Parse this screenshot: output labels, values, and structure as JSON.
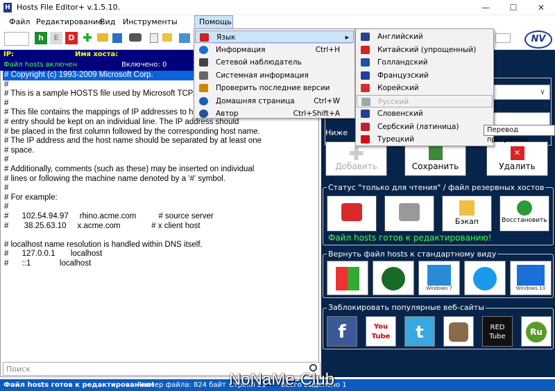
{
  "window": {
    "title": "Hosts File Editor+ v.1.5.10.",
    "icon_letter": "H",
    "min": "—",
    "max": "☐",
    "close": "✕"
  },
  "menubar": {
    "items": [
      "Файл",
      "Редактирование",
      "Вид",
      "Инструменты"
    ],
    "help": "Помощь"
  },
  "toolbar": {
    "h": "h",
    "e": "E",
    "d": "D"
  },
  "table_header": {
    "ip": "IP:",
    "host": "Имя хоста:"
  },
  "hosts_bar": {
    "left": "Файл hosts включен",
    "right": "Включено: 0"
  },
  "hosts_lines": [
    "# Copyright (c) 1993-2009 Microsoft Corp.",
    "#",
    "# This is a sample HOSTS file used by Microsoft TCP/I",
    "#",
    "# This file contains the mappings of IP addresses to ho",
    "# entry should be kept on an individual line. The IP address should",
    "# be placed in the first column followed by the corresponding host name.",
    "# The IP address and the host name should be separated by at least one",
    "# space.",
    "#",
    "# Additionally, comments (such as these) may be inserted on individual",
    "# lines or following the machine name denoted by a '#' symbol.",
    "#",
    "# For example:",
    "#",
    "#      102.54.94.97     rhino.acme.com          # source server",
    "#       38.25.63.10     x.acme.com              # x client host",
    "",
    "# localhost name resolution is handled within DNS itself.",
    "#\t127.0.0.1       localhost",
    "#\t::1             localhost"
  ],
  "search": {
    "placeholder": "Поиск"
  },
  "right_panel": {
    "below_label": "Ниже",
    "add": "Добавить",
    "save": "Сохранить",
    "delete": "Удалить",
    "readonly_title": "Статус \"только для чтения\" / файл резервных хостов",
    "backup": "Бэкап",
    "restore": "Восстановить",
    "ready": "Файл hosts готов к редактированию!",
    "reset_title": "Вернуть файл hosts к стандартному виду",
    "win_labels": [
      "",
      "",
      "Windows 7",
      "",
      "Windows 10"
    ],
    "block_title": "Заблокировать популярные веб-сайты",
    "sites": [
      "f",
      "You Tube",
      "t",
      "",
      "RED Tube",
      "Ru"
    ]
  },
  "help_menu": [
    {
      "label": "Язык",
      "shortcut": "",
      "color": "#c22",
      "submenu": true
    },
    {
      "label": "Информация",
      "shortcut": "Ctrl+H",
      "color": "#1a6fd0"
    },
    {
      "label": "Сетевой наблюдатель",
      "shortcut": "",
      "color": "#444"
    },
    {
      "label": "Системная информация",
      "shortcut": "",
      "color": "#666"
    },
    {
      "label": "Проверить последние версии",
      "shortcut": "",
      "color": "#c80"
    },
    {
      "label": "Домашняя страница",
      "shortcut": "Ctrl+W",
      "color": "#1a5fb0"
    },
    {
      "label": "Автор",
      "shortcut": "Ctrl+Shift+A",
      "color": "#2a4f9a"
    }
  ],
  "lang_menu": [
    {
      "label": "Английский",
      "color": "#2a3f8f"
    },
    {
      "label": "Китайский (упрощенный)",
      "color": "#d82020"
    },
    {
      "label": "Голландский",
      "color": "#2050a0"
    },
    {
      "label": "Французский",
      "color": "#2040a0"
    },
    {
      "label": "Корейский",
      "color": "#d03030"
    },
    {
      "label": "Русский",
      "color": "#9aa"
    },
    {
      "label": "Словенский",
      "color": "#2040a0"
    },
    {
      "label": "Сербский (латиница)",
      "color": "#c02030"
    },
    {
      "label": "Турецкий",
      "color": "#d01010"
    }
  ],
  "tooltip": "Перевод программы",
  "status": {
    "left": "Файл hosts готов к редактированию!",
    "size": "Размер файла:  824 байт",
    "lines": "Строки 21",
    "selected": "Всего выделено 1"
  },
  "watermark": "NoNaMe-Club",
  "colors": {
    "panel": "#07244a",
    "header": "#00007a",
    "status": "#0a5cc0",
    "selection": "#0a64d7"
  }
}
